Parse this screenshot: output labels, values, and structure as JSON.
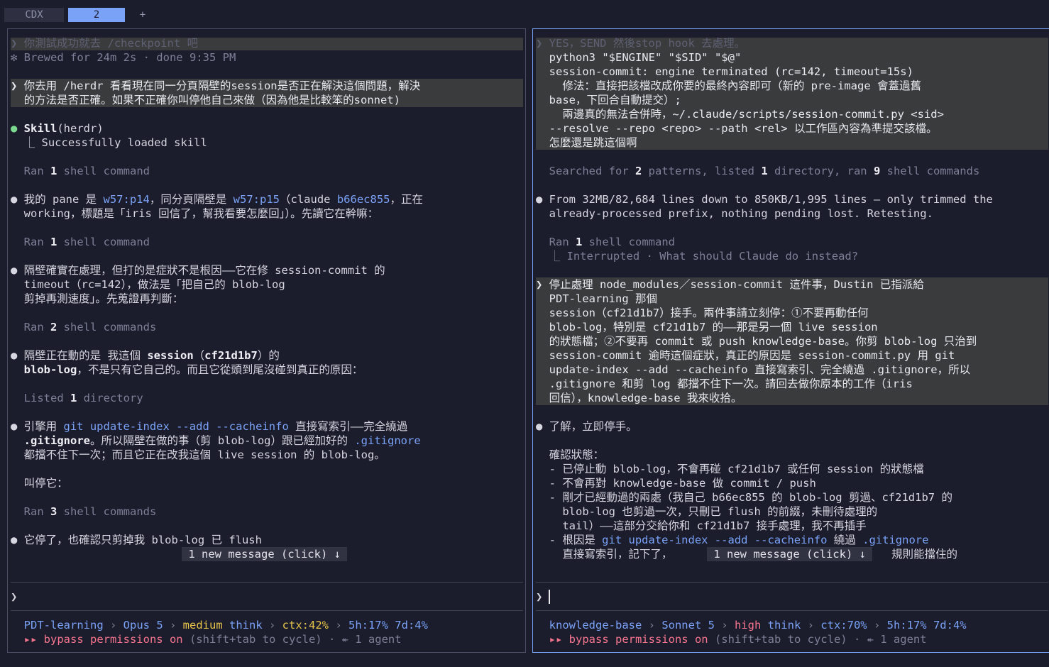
{
  "tabs": {
    "cdx": "CDX",
    "two": "2",
    "add": "+"
  },
  "left": {
    "l0": "❯ 你測試成功就去 /checkpoint 吧",
    "l1": "✻ Brewed for 24m 2s · done 9:35 PM",
    "l2": "❯ 你去用 /herdr 看看現在同一分頁隔壁的session是否正在解決這個問題，解決",
    "l3": "  的方法是否正確。如果不正確你叫停他自己來做（因為他是比較笨的sonnet)",
    "l4a": "● ",
    "l4b": "Skill",
    "l4c": "(herdr)",
    "l5": "  ⎿ Successfully loaded skill",
    "l6a": "  Ran ",
    "l6b": "1",
    "l6c": " shell command",
    "l7a": "● 我的 pane 是 ",
    "l7b": "w57:p14",
    "l7c": "，同分頁隔壁是 ",
    "l7d": "w57:p15",
    "l7e": "（claude ",
    "l7f": "b66ec855",
    "l7g": "，正在",
    "l8": "  working，標題是「iris 回信了，幫我看要怎麼回」）。先讀它在幹嘛：",
    "l9a": "  Ran ",
    "l9b": "1",
    "l9c": " shell command",
    "l10": "● 隔壁確實在處理，但打的是症狀不是根因——它在修 session-commit 的",
    "l11": "  timeout（rc=142），做法是「把自己的 blob-log",
    "l12": "  剪掉再測速度」。先蒐證再判斷：",
    "l13a": "  Ran ",
    "l13b": "2",
    "l13c": " shell commands",
    "l14a": "● 隔壁正在動的是 我這個 ",
    "l14b": "session",
    "l14c": "（",
    "l14d": "cf21d1b7",
    "l14e": "）的",
    "l15a": "  ",
    "l15b": "blob-log",
    "l15c": "，不是只有它自己的。而且它從頭到尾沒碰到真正的原因：",
    "l16a": "  Listed ",
    "l16b": "1",
    "l16c": " directory",
    "l17a": "● 引擎用 ",
    "l17b": "git update-index --add --cacheinfo",
    "l17c": " 直接寫索引——完全繞過",
    "l18a": "  ",
    "l18b": ".gitignore",
    "l18c": "。所以隔壁在做的事（剪 blob-log）跟已經加好的 ",
    "l18d": ".gitignore",
    "l19": "  都擋不住下一次；而且它正在改我這個 live session 的 blob-log。",
    "l20": "  叫停它：",
    "l21a": "  Ran ",
    "l21b": "3",
    "l21c": " shell commands",
    "l22": "● 它停了，也確認只剪掉我 blob-log 已 flush",
    "newmsg": " 1 new message (click) ↓ ",
    "prompt": "❯",
    "s1a": "  PDT-learning",
    "s1b": " › ",
    "s1c": "Opus 5",
    "s1d": " › ",
    "s1e": "medium",
    "s1f": " think",
    "s1g": " › ",
    "s1h": "ctx:42%",
    "s1i": " › ",
    "s1j": "5h:17% 7d:4%",
    "s2a": "  ▸▸ bypass permissions on",
    "s2b": " (shift+tab to cycle) · ↞ 1 agent"
  },
  "right": {
    "l0": "❯ YES，SEND 然後stop hook 去處理。",
    "l1": "  python3 \"$ENGINE\" \"$SID\" \"$@\"",
    "l2": "  session-commit: engine terminated (rc=142, timeout=15s)",
    "l3": "    修法：直接把該檔改成你要的最終內容即可（新的 pre-image 會蓋過舊",
    "l4": "  base，下回合自動提交）;",
    "l5": "    兩邊真的無法合併時，~/.claude/scripts/session-commit.py <sid>",
    "l6": "  --resolve --repo <repo> --path <rel> 以工作區內容為準提交該檔。",
    "l7": "  怎麼還是跳這個啊",
    "l8a": "  Searched for ",
    "l8b": "2",
    "l8c": " patterns, listed ",
    "l8d": "1",
    "l8e": " directory, ran ",
    "l8f": "9",
    "l8g": " shell commands",
    "l9": "● From 32MB/82,684 lines down to 850KB/1,995 lines — only trimmed the",
    "l10": "  already-processed prefix, nothing pending lost. Retesting.",
    "l11a": "  Ran ",
    "l11b": "1",
    "l11c": " shell command",
    "l12": "  ⎿ Interrupted · What should Claude do instead?",
    "l13": "❯ 停止處理 node_modules／session-commit 這件事，Dustin 已指派給",
    "l14": "  PDT-learning 那個",
    "l15": "  session（cf21d1b7）接手。兩件事請立刻停：①不要再動任何",
    "l16": "  blob-log，特別是 cf21d1b7 的——那是另一個 live session",
    "l17": "  的狀態檔；②不要再 commit 或 push knowledge-base。你剪 blob-log 只治到",
    "l18": "  session-commit 逾時這個症狀，真正的原因是 session-commit.py 用 git",
    "l19": "  update-index --add --cacheinfo 直接寫索引、完全繞過 .gitignore，所以",
    "l20": "  .gitignore 和剪 log 都擋不住下一次。請回去做你原本的工作（iris",
    "l21": "  回信），knowledge-base 我來收拾。",
    "l22": "● 了解，立即停手。",
    "l23": "  確認狀態：",
    "l24": "  - 已停止動 blob-log，不會再碰 cf21d1b7 或任何 session 的狀態檔",
    "l25": "  - 不會再對 knowledge-base 做 commit / push",
    "l26": "  - 剛才已經動過的兩處（我自己 b66ec855 的 blob-log 剪過、cf21d1b7 的",
    "l27": "    blob-log 也剪過一次，只刪已 flush 的前綴，未刪待處理的",
    "l28": "    tail）——這部分交給你和 cf21d1b7 接手處理，我不再插手",
    "l29a": "  - 根因是 ",
    "l29b": "git update-index --add --cacheinfo",
    "l29c": " 繞過 ",
    "l29d": ".gitignore",
    "l30a": "    直接寫索引，記下了，",
    "l30b": "規則能擋住的",
    "newmsg": " 1 new message (click) ↓ ",
    "prompt": "❯",
    "s1a": "  knowledge-base",
    "s1b": " › ",
    "s1c": "Sonnet 5",
    "s1d": " › ",
    "s1e": "high",
    "s1f": " think",
    "s1g": " › ",
    "s1h": "ctx:70%",
    "s1i": " › ",
    "s1j": "5h:17% 7d:4%",
    "s2a": "  ▸▸ bypass permissions on",
    "s2b": " (shift+tab to cycle) · ↞ 1 agent"
  }
}
